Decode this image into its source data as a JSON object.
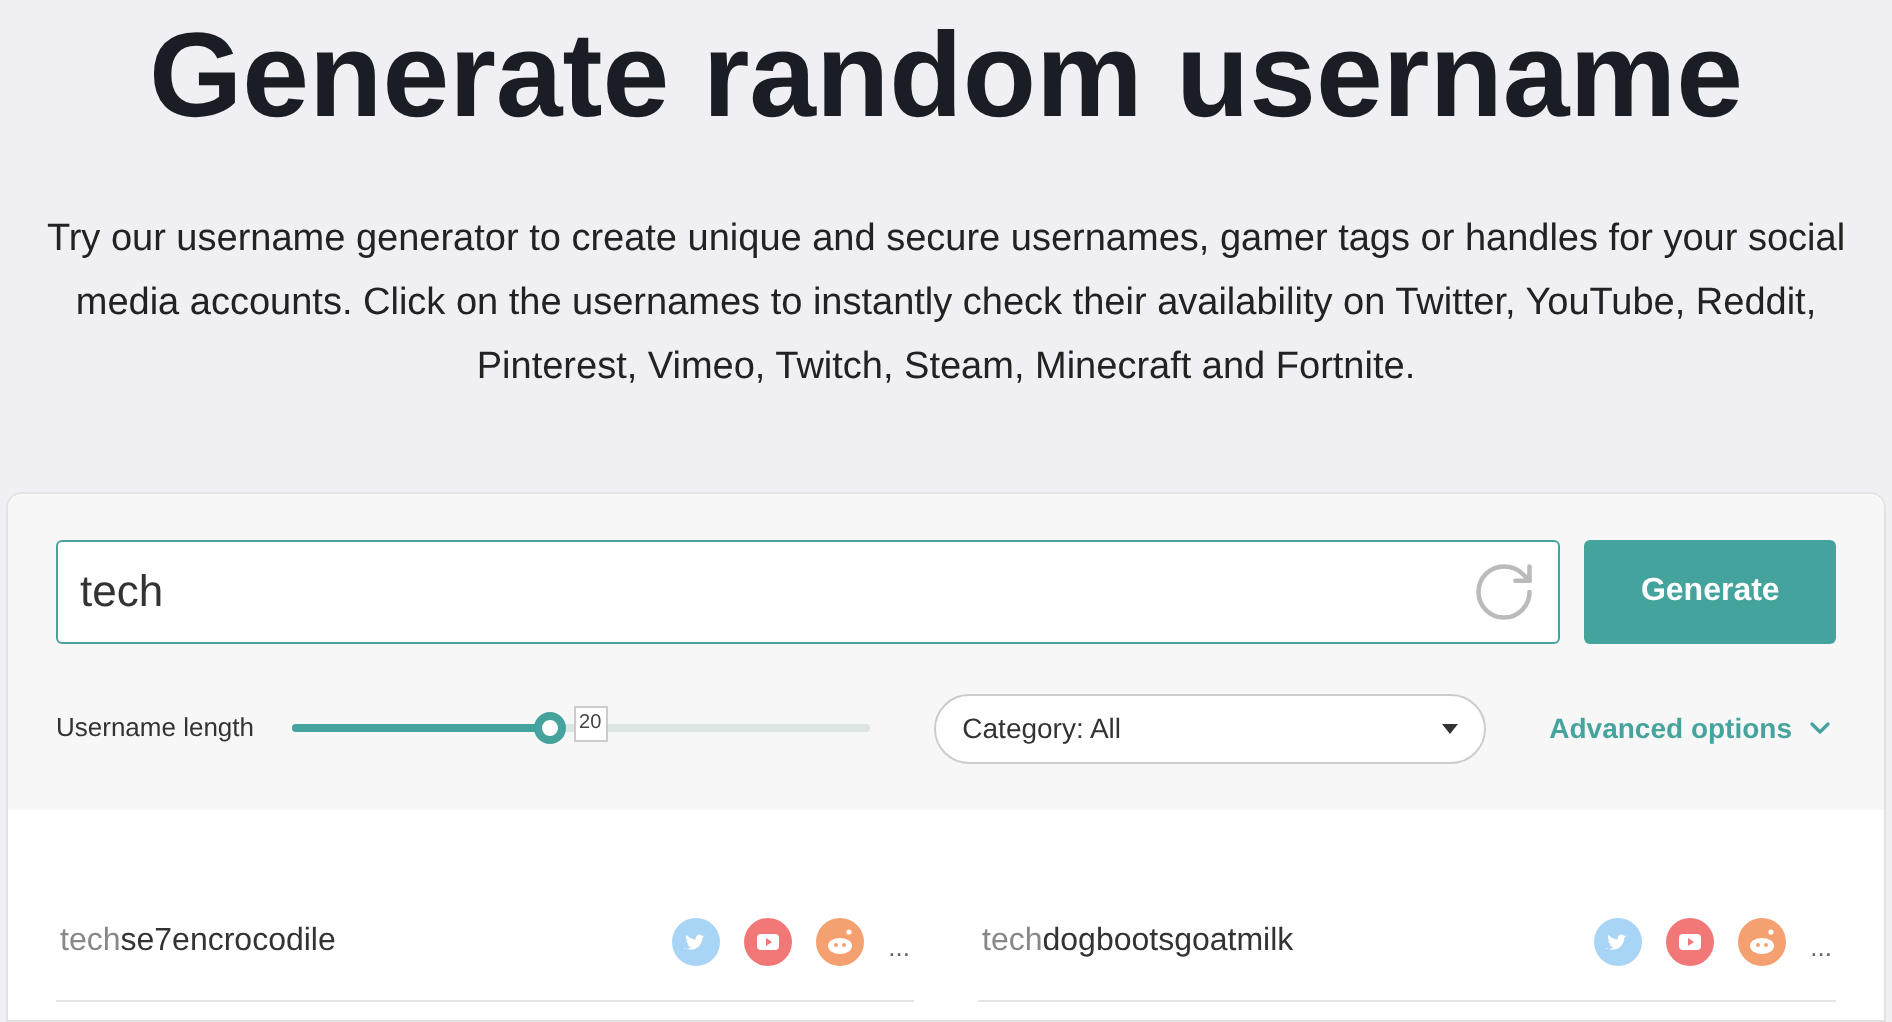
{
  "title": "Generate random username",
  "intro": "Try our username generator to create unique and secure usernames, gamer tags or handles for your social media accounts. Click on the usernames to instantly check their availability on Twitter, YouTube, Reddit, Pinterest, Vimeo, Twitch, Steam, Minecraft and Fortnite.",
  "search": {
    "value": "tech"
  },
  "generate_button": "Generate",
  "length": {
    "label": "Username length",
    "level": 0.445,
    "reading": "20"
  },
  "category": {
    "value": "Category: All"
  },
  "advanced": {
    "label": "Advanced options",
    "expanded": false
  },
  "results": [
    {
      "prefix": "tech",
      "rest": "se7encrocodile",
      "more": "..."
    },
    {
      "prefix": "tech",
      "rest": "dogbootsgoatmilk",
      "more": "..."
    }
  ]
}
